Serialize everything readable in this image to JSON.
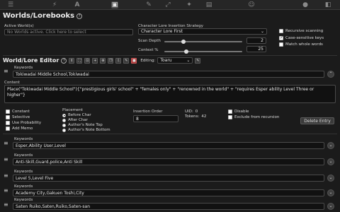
{
  "topbar": {
    "icons": [
      "sliders-icon",
      "plug-icon",
      "font-icon",
      "book-icon",
      "wrench-icon",
      "expand-icon",
      "puzzle-icon",
      "image-icon",
      "smile-icon",
      "user-icon",
      "users-icon"
    ],
    "letters": {
      "font": "A"
    }
  },
  "worlds": {
    "title": "Worlds/Lorebooks",
    "help": "?",
    "active_label": "Active World(s)",
    "active_placeholder": "No Worlds active. Click here to select",
    "strategy_label": "Character Lore Insertion Strategy",
    "strategy_value": "Character Lore First",
    "scan_depth_label": "Scan Depth",
    "scan_depth_value": "2",
    "context_label": "Context %",
    "context_value": "25",
    "opt_recursive": "Recursive scanning",
    "opt_case": "Case-sensitive keys",
    "opt_whole": "Match whole words"
  },
  "editor": {
    "title": "World/Lore Editor",
    "help": "?",
    "editing_label": "Editing:",
    "editing_value": "Toaru",
    "entry": {
      "keywords_label": "Keywords",
      "keywords_value": "Tokiwadai Middle School,Tokiwadai",
      "content_label": "Content",
      "content_value": "Place(\"Tokiwadai Middle School\"){\"prestigious girls' school\" + \"females only\" + \"renowned in the world\" + \"requires Esper ability Level Three or higher\"}",
      "constant": "Constant",
      "selective": "Selective",
      "use_probability": "Use Probability",
      "add_memo": "Add Memo",
      "placement_label": "Placement",
      "placement_options": [
        "Before Char",
        "After Char",
        "Author's Note Top",
        "Author's Note Bottom"
      ],
      "insertion_label": "Insertion Order",
      "insertion_value": "8",
      "uid_label": "UID:",
      "uid_value": "0",
      "tokens_label": "Tokens:",
      "tokens_value": "42",
      "disable": "Disable",
      "exclude": "Exclude from recursion",
      "delete": "Delete Entry"
    },
    "collapsed": [
      {
        "keywords_label": "Keywords",
        "keywords_value": "Esper,Ability User,Level"
      },
      {
        "keywords_label": "Keywords",
        "keywords_value": "Anti-Skill,Guard,police,Anti Skill"
      },
      {
        "keywords_label": "Keywords",
        "keywords_value": "Level 5,Level Five"
      },
      {
        "keywords_label": "Keywords",
        "keywords_value": "Academy City,Gakuen Toshi,City"
      },
      {
        "keywords_label": "Keywords",
        "keywords_value": "Saten Ruiko,Saten,Ruiko,Saten-san"
      }
    ]
  }
}
